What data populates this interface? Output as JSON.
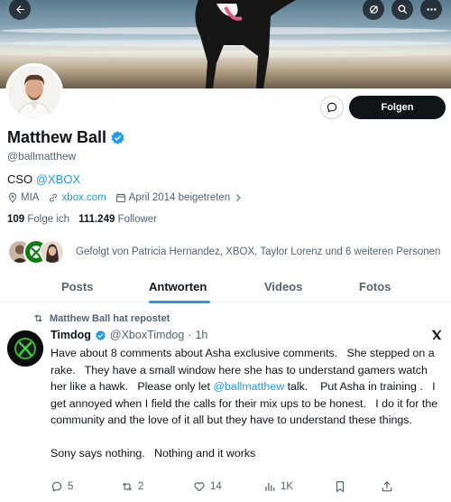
{
  "header": {
    "back_icon": "arrow-left-icon",
    "actions": [
      "hide-reposts-icon",
      "search-icon",
      "more-icon"
    ]
  },
  "profile": {
    "name": "Matthew Ball",
    "handle": "@ballmatthew",
    "bio_prefix": "CSO ",
    "bio_link": "@XBOX",
    "location": "MIA",
    "website": "xbox.com",
    "joined": "April 2014 beigetreten",
    "following_count": "109",
    "following_label": "Folge ich",
    "followers_count": "111.249",
    "followers_label": "Follower",
    "follow_button": "Folgen",
    "followed_by": "Gefolgt von Patricia Hernandez, XBOX, Taylor Lorenz und 6 weiteren Personen"
  },
  "tabs": [
    {
      "label": "Posts",
      "active": false
    },
    {
      "label": "Antworten",
      "active": true
    },
    {
      "label": "Videos",
      "active": false
    },
    {
      "label": "Fotos",
      "active": false
    }
  ],
  "tweet": {
    "repost_label": "Matthew Ball hat repostet",
    "author_name": "Timdog",
    "author_handle": "@XboxTimdog",
    "sep": "·",
    "time": "1h",
    "text_before_mention": "Have about 8 comments about Asha exclusive comments.   She stepped on a rake.   They have a small window here she has to understand gamers watch her like a hawk.   Please only let ",
    "mention": "@ballmatthew",
    "text_after_mention": " talk.    Put Asha in training .   I get annoyed when I field the calls for their mix ups to be honest.   I do it for the community and the love of it all but they have to understand these things.",
    "text_p2": "Sony says nothing.   Nothing and it works",
    "replies": "5",
    "reposts": "2",
    "likes": "14",
    "views": "1K"
  },
  "colors": {
    "accent": "#1d9bf0",
    "text": "#0f1419",
    "muted": "#536471",
    "xbox_green": "#107c10"
  }
}
